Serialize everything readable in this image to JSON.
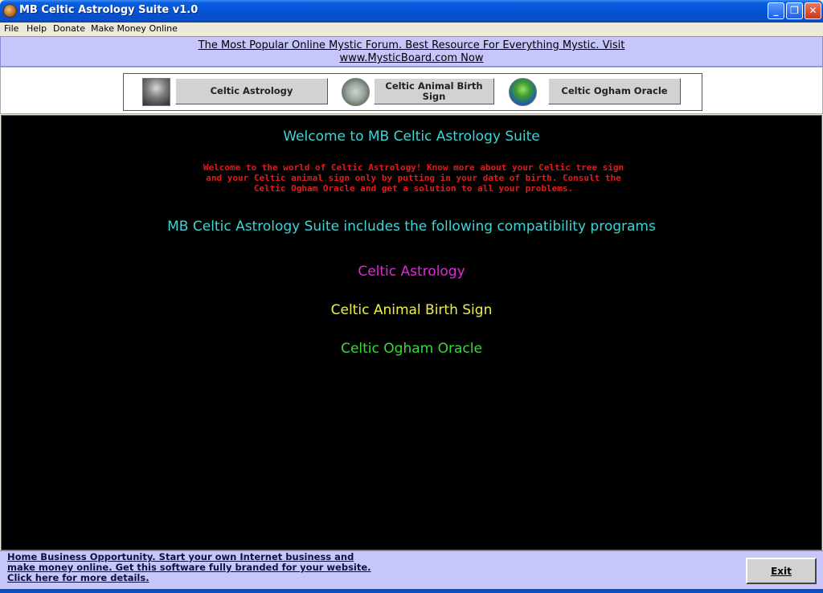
{
  "window": {
    "title": "MB Celtic Astrology Suite v1.0",
    "buttons": {
      "minimize": "_",
      "maximize": "❐",
      "close": "✕"
    }
  },
  "menu": {
    "items": [
      "File",
      "Help",
      "Donate",
      "Make Money Online"
    ]
  },
  "top_banner": {
    "line1": "The Most Popular Online Mystic Forum. Best Resource For Everything Mystic. Visit",
    "line2": "www.MysticBoard.com Now"
  },
  "toolbar": {
    "buttons": [
      {
        "label": "Celtic Astrology",
        "icon": "tree-icon"
      },
      {
        "label": "Celtic Animal Birth Sign",
        "icon": "animal-icon"
      },
      {
        "label": "Celtic Ogham Oracle",
        "icon": "ogham-icon"
      }
    ]
  },
  "main": {
    "welcome_title": "Welcome to MB Celtic Astrology Suite",
    "welcome_text": "Welcome to the world of Celtic Astrology! Know more about your Celtic tree sign and your Celtic animal sign only by putting in your date of birth. Consult the Celtic Ogham Oracle and get a solution to all your problems.",
    "includes_text": "MB Celtic Astrology Suite includes the following compatibility programs",
    "programs": [
      {
        "label": "Celtic Astrology",
        "color": "#de2cd8"
      },
      {
        "label": "Celtic Animal Birth Sign",
        "color": "#efef4a"
      },
      {
        "label": "Celtic Ogham Oracle",
        "color": "#3ad93a"
      }
    ]
  },
  "bottom": {
    "link_line1": "Home Business Opportunity. Start your own Internet business and",
    "link_line2": "make money online. Get this software fully branded for your website.",
    "link_line3": "Click here for more details.",
    "exit_label": "Exit"
  },
  "colors": {
    "titlebar": "#0553d6",
    "banner_bg": "#c7c6fb",
    "main_bg": "#000000",
    "cyan_text": "#3fd4d6",
    "red_text": "#e31b1b"
  }
}
